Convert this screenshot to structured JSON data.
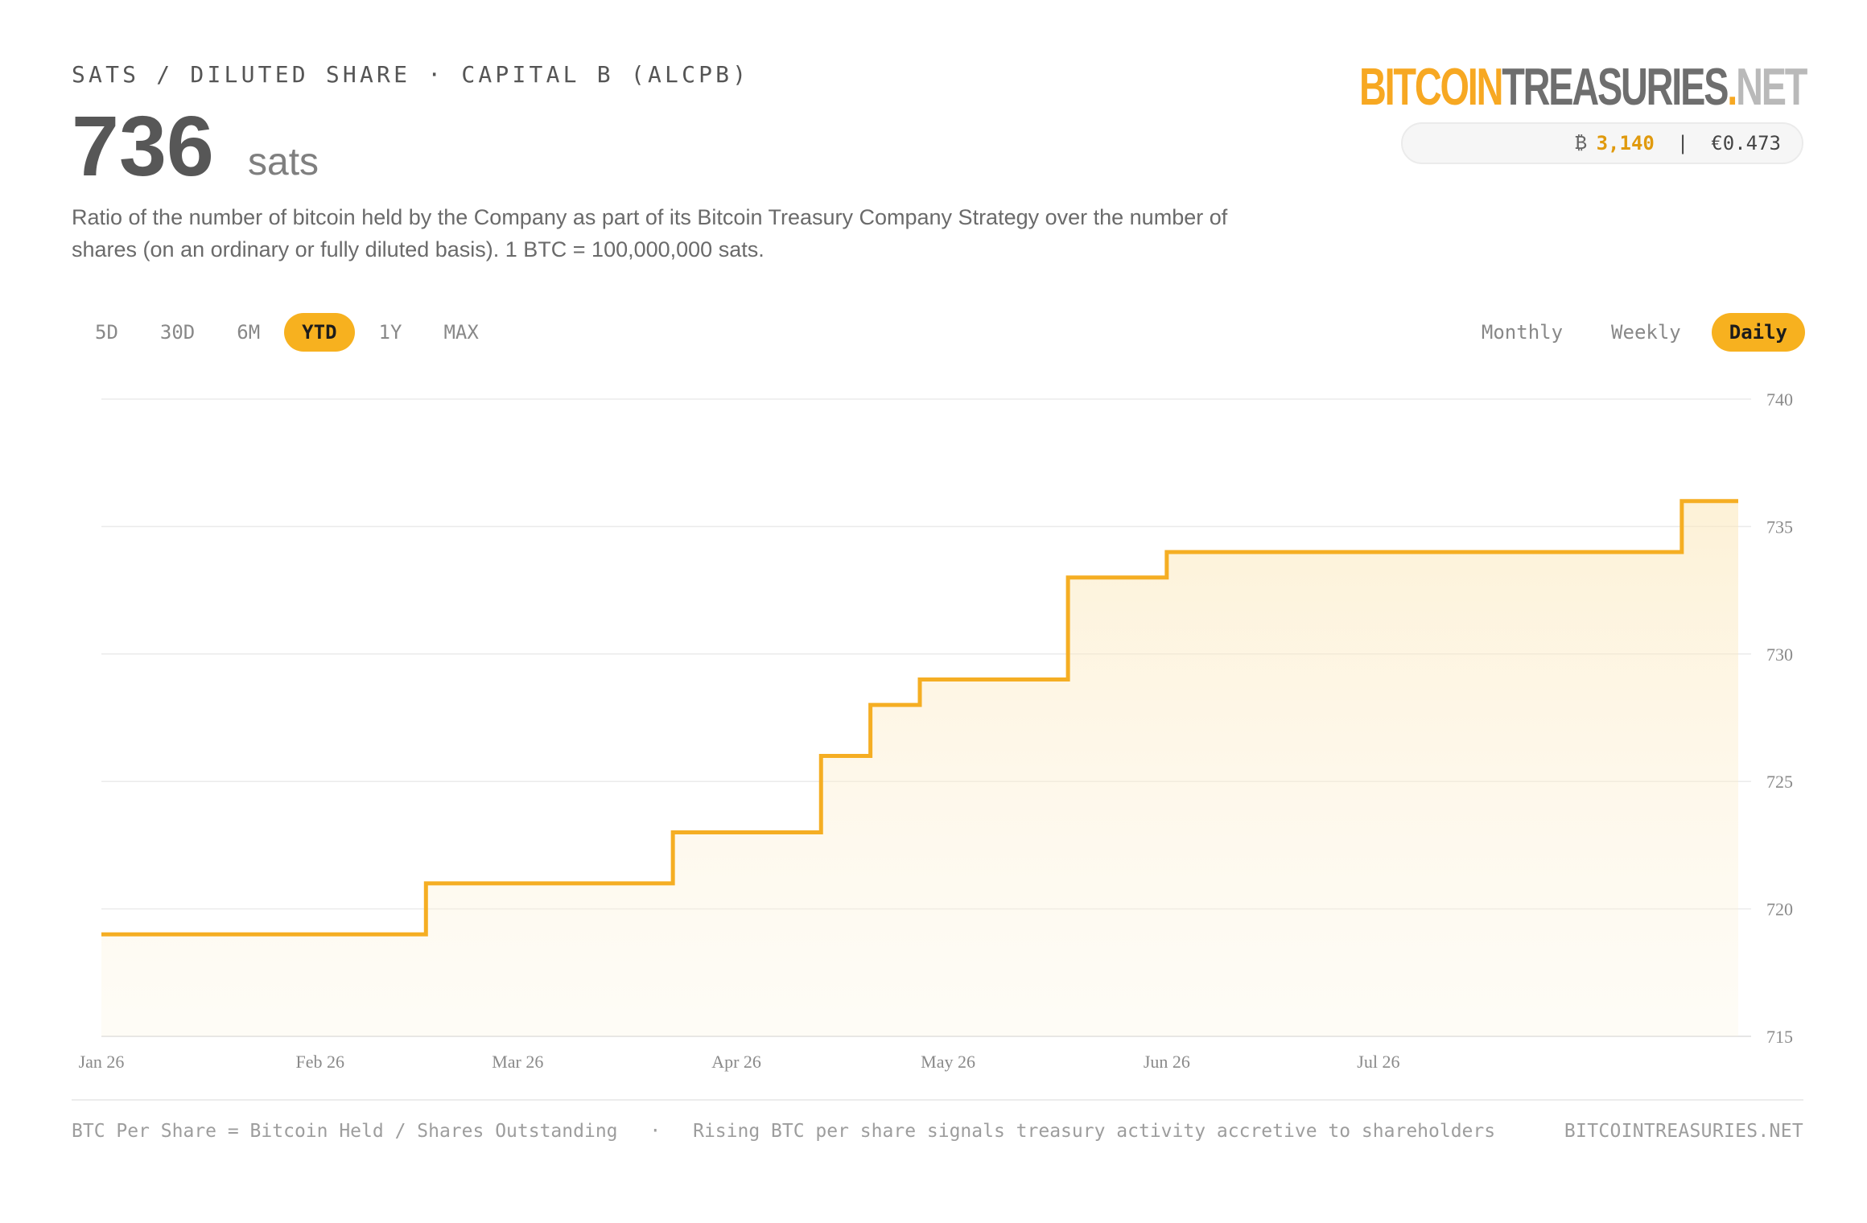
{
  "header": {
    "subtitle": "SATS / DILUTED SHARE · CAPITAL B (ALCPB)",
    "value": "736",
    "unit": "sats",
    "description": "Ratio of the number of bitcoin held by the Company as part of its Bitcoin Treasury Company Strategy over the number of shares (on an ordinary or fully diluted basis). 1 BTC = 100,000,000 sats."
  },
  "brand": {
    "part1": "BITCOIN",
    "part2": "TREASURIES",
    "part3": ".",
    "part4": "NET"
  },
  "price": {
    "btc_symbol": "₿",
    "btc_holdings": "3,140",
    "separator": "|",
    "share_price": "€0.473"
  },
  "range_tabs": [
    {
      "label": "5D",
      "active": false
    },
    {
      "label": "30D",
      "active": false
    },
    {
      "label": "6M",
      "active": false
    },
    {
      "label": "YTD",
      "active": true
    },
    {
      "label": "1Y",
      "active": false
    },
    {
      "label": "MAX",
      "active": false
    }
  ],
  "interval_tabs": [
    {
      "label": "Monthly",
      "active": false
    },
    {
      "label": "Weekly",
      "active": false
    },
    {
      "label": "Daily",
      "active": true
    }
  ],
  "colors": {
    "accent": "#f7b11f",
    "line": "#f5ae23",
    "grid": "#ebebeb",
    "tick_text": "#8a8a8a"
  },
  "chart_data": {
    "type": "area",
    "step": true,
    "title": "",
    "xlabel": "",
    "ylabel": "",
    "x_range": [
      "2026-01-01",
      "2026-08-21"
    ],
    "ylim": [
      715,
      740
    ],
    "yticks": [
      715,
      720,
      725,
      730,
      735,
      740
    ],
    "y_axis_position": "right",
    "x_tick_labels": [
      {
        "label": "Jan 26",
        "date": "2026-01-01"
      },
      {
        "label": "Feb 26",
        "date": "2026-02-01"
      },
      {
        "label": "Mar 26",
        "date": "2026-03-01"
      },
      {
        "label": "Apr 26",
        "date": "2026-04-01"
      },
      {
        "label": "May 26",
        "date": "2026-05-01"
      },
      {
        "label": "Jun 26",
        "date": "2026-06-01"
      },
      {
        "label": "Jul 26",
        "date": "2026-07-01"
      }
    ],
    "grid": true,
    "legend": "none",
    "series": [
      {
        "points": [
          {
            "x": "2026-01-01",
            "y": 719
          },
          {
            "x": "2026-02-16",
            "y": 721
          },
          {
            "x": "2026-03-23",
            "y": 723
          },
          {
            "x": "2026-04-13",
            "y": 726
          },
          {
            "x": "2026-04-20",
            "y": 728
          },
          {
            "x": "2026-04-27",
            "y": 729
          },
          {
            "x": "2026-05-18",
            "y": 733
          },
          {
            "x": "2026-06-01",
            "y": 734
          },
          {
            "x": "2026-08-13",
            "y": 736
          },
          {
            "x": "2026-08-21",
            "y": 736
          }
        ]
      }
    ]
  },
  "footer": {
    "formula": "BTC Per Share = Bitcoin Held / Shares Outstanding",
    "dot": "·",
    "note": "Rising BTC per share signals treasury activity accretive to shareholders",
    "site": "BITCOINTREASURIES.NET"
  }
}
